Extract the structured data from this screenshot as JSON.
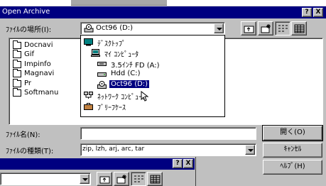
{
  "window": {
    "title": "Open Archive",
    "help_glyph": "?",
    "close_glyph": "X"
  },
  "lookin": {
    "label": "ﾌｧｲﾙの場所(I):",
    "value": "Oct96 (D:)"
  },
  "files": [
    "Docnavi",
    "Gif",
    "Impinfo",
    "Magnavi",
    "Pr",
    "Softmanu"
  ],
  "dropdown": {
    "items": [
      {
        "label": "ﾃﾞｽｸﾄｯﾌﾟ",
        "icon": "desktop-icon",
        "selected": false
      },
      {
        "label": "ﾏｲ ｺﾝﾋﾟｭｰﾀ",
        "icon": "my-computer-icon",
        "selected": false
      },
      {
        "label": "3.5ｲﾝﾁ FD (A:)",
        "icon": "floppy-drive-icon",
        "selected": false
      },
      {
        "label": "Hdd (C:)",
        "icon": "hard-drive-icon",
        "selected": false
      },
      {
        "label": "Oct96 (D:)",
        "icon": "cd-drive-icon",
        "selected": true
      },
      {
        "label": "ﾈｯﾄﾜｰｸ ｺﾝﾋﾟｭｰﾀ",
        "icon": "network-icon",
        "selected": false
      },
      {
        "label": "ﾌﾞﾘｰﾌｹｰｽ",
        "icon": "briefcase-icon",
        "selected": false
      }
    ]
  },
  "filename": {
    "label": "ﾌｧｲﾙ名(N):",
    "value": ""
  },
  "filetype": {
    "label": "ﾌｧｲﾙの種類(T):",
    "value": "zip, lzh, arj, arc, tar"
  },
  "buttons": {
    "open": "開く(O)",
    "cancel": "ｷｬﾝｾﾙ",
    "help": "ﾍﾙﾌﾟ(H)"
  },
  "dialog2": {
    "help_glyph": "?",
    "close_glyph": "X"
  },
  "colors": {
    "titlebar": "#000080",
    "face": "#c0c0c0",
    "selection": "#000080"
  }
}
